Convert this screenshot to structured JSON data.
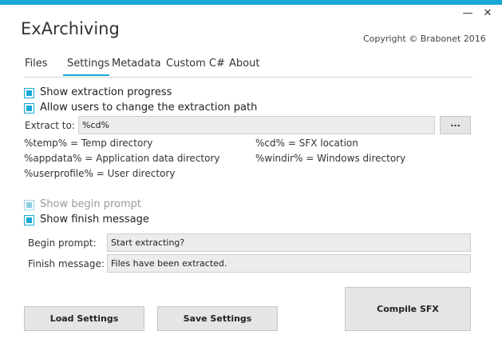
{
  "window": {
    "title": "ExArchiving",
    "copyright": "Copyright © Brabonet 2016",
    "minimize_glyph": "—",
    "close_glyph": "✕",
    "accent_color": "#19a7d8"
  },
  "tabs": [
    {
      "label": "Files",
      "active": false
    },
    {
      "label": "Settings",
      "active": true
    },
    {
      "label": "Metadata",
      "active": false
    },
    {
      "label": "Custom C#",
      "active": false
    },
    {
      "label": "About",
      "active": false
    }
  ],
  "settings": {
    "show_progress": {
      "label": "Show extraction progress",
      "checked": true
    },
    "allow_path_change": {
      "label": "Allow users to change the extraction path",
      "checked": true
    },
    "extract_to": {
      "label": "Extract to:",
      "value": "%cd%",
      "browse_label": "..."
    },
    "hints": [
      "%temp% = Temp directory",
      "%cd% = SFX location",
      "%appdata% = Application data directory",
      "%windir% = Windows directory",
      "%userprofile% = User directory"
    ],
    "show_begin_prompt": {
      "label": "Show begin prompt",
      "checked": true,
      "enabled": false
    },
    "show_finish_message": {
      "label": "Show finish message",
      "checked": true
    },
    "begin_prompt": {
      "label": "Begin prompt:",
      "value": "Start extracting?"
    },
    "finish_message": {
      "label": "Finish message:",
      "value": "Files have been extracted."
    }
  },
  "buttons": {
    "load": "Load Settings",
    "save": "Save Settings",
    "compile": "Compile SFX"
  }
}
